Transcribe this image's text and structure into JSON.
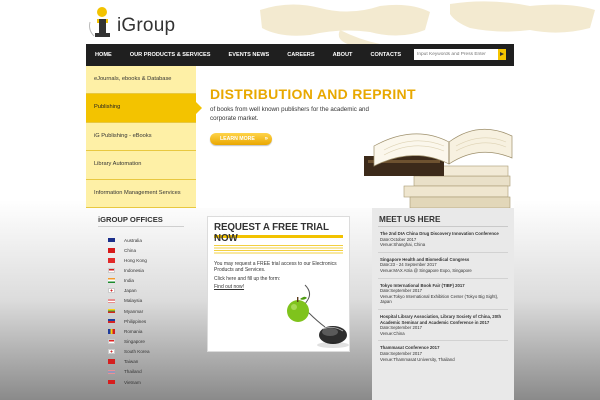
{
  "brand": {
    "name": "iGroup"
  },
  "nav": {
    "items": [
      "HOME",
      "OUR PRODUCTS & SERVICES",
      "EVENTS NEWS",
      "CAREERS",
      "ABOUT",
      "CONTACTS"
    ],
    "search_placeholder": "Input Keywords and Press Enter"
  },
  "side_menu": {
    "items": [
      "eJournals, ebooks & Database",
      "Publishing",
      "iG Publishing - eBooks",
      "Library Automation",
      "Information Management Services"
    ],
    "active_index": 1
  },
  "hero": {
    "title": "DISTRIBUTION AND REPRINT",
    "subtitle": "of books from well known publishers for the academic and corporate market.",
    "button": "LEARN MORE"
  },
  "offices": {
    "title": "iGROUP OFFICES",
    "items": [
      "Australia",
      "China",
      "Hong Kong",
      "Indonesia",
      "India",
      "Japan",
      "Malaysia",
      "Myanmar",
      "Philippines",
      "Romania",
      "Singapore",
      "South Korea",
      "Taiwan",
      "Thailand",
      "Vietnam"
    ]
  },
  "trial": {
    "title": "REQUEST A FREE TRIAL NOW",
    "text": "You may request a FREE trial access to our Electronics Products and Services.",
    "text2": "Click here and fill up the form:",
    "link": "Find out now!"
  },
  "meet": {
    "title": "MEET US HERE",
    "events": [
      {
        "title": "The 2nd DIA China Drug Discovery Innovation Conference",
        "date": "Date:October 2017",
        "venue": "Venue:Shanghai, China"
      },
      {
        "title": "Singapore Health and Biomedical Congress",
        "date": "Date:23 - 24 September 2017",
        "venue": "Venue:MAX Atria @ Singapore Expo, Singapore"
      },
      {
        "title": "Tokyo International Book Fair (TIBF) 2017",
        "date": "Date:September 2017",
        "venue": "Venue:Tokyo International Exhibition Center (Tokyo Big Sight), Japan"
      },
      {
        "title": "Hospital Library Association, Library Society of China, 20th Academic Seminar and Academic Conference in 2017",
        "date": "Date:September 2017",
        "venue": "Venue:China"
      },
      {
        "title": "Thammasat Conference 2017",
        "date": "Date:September 2017",
        "venue": "Venue:Thammasat University, Thailand"
      }
    ]
  },
  "colors": {
    "accent": "#f3c300",
    "nav_bg": "#1f1f1f",
    "hero_title": "#e8a800"
  }
}
